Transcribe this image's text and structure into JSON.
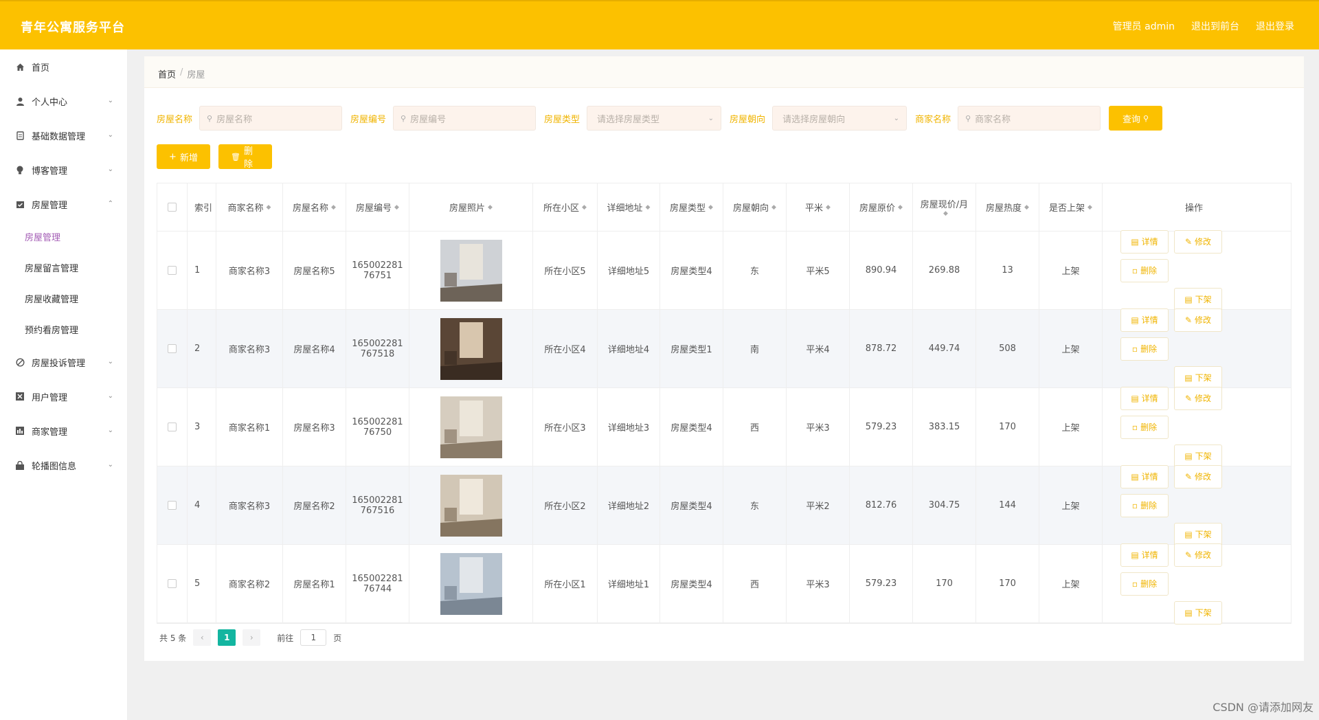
{
  "app": {
    "title": "青年公寓服务平台",
    "user_label": "管理员 admin",
    "exit_to_front": "退出到前台",
    "logout": "退出登录"
  },
  "sidebar": {
    "items": [
      {
        "label": "首页",
        "icon": "home-icon",
        "expandable": false
      },
      {
        "label": "个人中心",
        "icon": "user-icon",
        "expandable": true
      },
      {
        "label": "基础数据管理",
        "icon": "database-icon",
        "expandable": true
      },
      {
        "label": "博客管理",
        "icon": "bulb-icon",
        "expandable": true
      },
      {
        "label": "房屋管理",
        "icon": "calendar-check-icon",
        "expandable": true,
        "open": true
      },
      {
        "label": "房屋投诉管理",
        "icon": "ban-icon",
        "expandable": true
      },
      {
        "label": "用户管理",
        "icon": "x-square-icon",
        "expandable": true
      },
      {
        "label": "商家管理",
        "icon": "chart-icon",
        "expandable": true
      },
      {
        "label": "轮播图信息",
        "icon": "lock-icon",
        "expandable": true
      }
    ],
    "sub_items": [
      "房屋管理",
      "房屋留言管理",
      "房屋收藏管理",
      "预约看房管理"
    ]
  },
  "breadcrumb": {
    "home": "首页",
    "separator": "/",
    "current": "房屋"
  },
  "filters": {
    "name_label": "房屋名称",
    "name_placeholder": "房屋名称",
    "code_label": "房屋编号",
    "code_placeholder": "房屋编号",
    "type_label": "房屋类型",
    "type_placeholder": "请选择房屋类型",
    "orient_label": "房屋朝向",
    "orient_placeholder": "请选择房屋朝向",
    "merchant_label": "商家名称",
    "merchant_placeholder": "商家名称",
    "query_button": "查询"
  },
  "toolbar": {
    "add": "新增",
    "delete": "删除"
  },
  "table": {
    "headers": [
      "索引",
      "商家名称",
      "房屋名称",
      "房屋编号",
      "房屋照片",
      "所在小区",
      "详细地址",
      "房屋类型",
      "房屋朝向",
      "平米",
      "房屋原价",
      "房屋现价/月",
      "房屋热度",
      "是否上架",
      "操作"
    ],
    "op_labels": {
      "detail": "详情",
      "edit": "修改",
      "delete": "删除",
      "offline": "下架"
    },
    "rows": [
      {
        "index": "1",
        "merchant": "商家名称3",
        "name": "房屋名称5",
        "code": "165002281 76751",
        "community": "所在小区5",
        "address": "详细地址5",
        "type": "房屋类型4",
        "orientation": "东",
        "area": "平米5",
        "original_price": "890.94",
        "current_price": "269.88",
        "heat": "13",
        "listed": "上架"
      },
      {
        "index": "2",
        "merchant": "商家名称3",
        "name": "房屋名称4",
        "code": "165002281 767518",
        "community": "所在小区4",
        "address": "详细地址4",
        "type": "房屋类型1",
        "orientation": "南",
        "area": "平米4",
        "original_price": "878.72",
        "current_price": "449.74",
        "heat": "508",
        "listed": "上架"
      },
      {
        "index": "3",
        "merchant": "商家名称1",
        "name": "房屋名称3",
        "code": "165002281 76750",
        "community": "所在小区3",
        "address": "详细地址3",
        "type": "房屋类型4",
        "orientation": "西",
        "area": "平米3",
        "original_price": "579.23",
        "current_price": "383.15",
        "heat": "170",
        "listed": "上架"
      },
      {
        "index": "4",
        "merchant": "商家名称3",
        "name": "房屋名称2",
        "code": "165002281 767516",
        "community": "所在小区2",
        "address": "详细地址2",
        "type": "房屋类型4",
        "orientation": "东",
        "area": "平米2",
        "original_price": "812.76",
        "current_price": "304.75",
        "heat": "144",
        "listed": "上架"
      },
      {
        "index": "5",
        "merchant": "商家名称2",
        "name": "房屋名称1",
        "code": "165002281 76744",
        "community": "所在小区1",
        "address": "详细地址1",
        "type": "房屋类型4",
        "orientation": "西",
        "area": "平米3",
        "original_price": "579.23",
        "current_price": "170",
        "heat": "170",
        "listed": "上架"
      }
    ]
  },
  "pager": {
    "total": "共 5 条",
    "page": "1",
    "goto_label": "前往",
    "goto_value": "1",
    "page_suffix": "页"
  },
  "watermark": "CSDN @请添加网友"
}
